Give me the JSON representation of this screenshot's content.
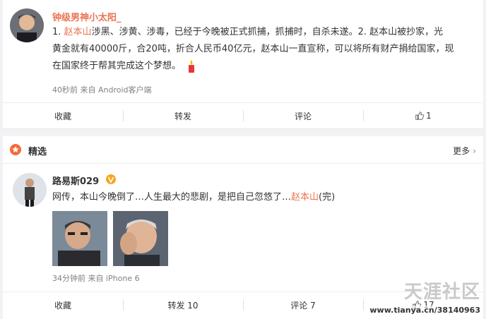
{
  "colors": {
    "accent": "#eb7350",
    "link": "#eb7350",
    "text": "#333333",
    "muted": "#808080",
    "verified": "#f5a623"
  },
  "post1": {
    "author": "钟级男神小太阳_",
    "line1_prefix": "1. ",
    "line1_name": "赵本山",
    "line1_rest": "涉黑、涉黄、涉毒，已经于今晚被正式抓捕，抓捕时，自杀未遂。2. 赵本山被抄家，光",
    "line2": "黄金就有40000斤，合20吨，折合人民币40亿元，赵本山一直宣称，可以将所有财产捐给国家，现",
    "line3": "在国家终于帮其完成这个梦想。",
    "emoji_icon": "candle-icon",
    "meta": "40秒前 来自 Android客户端",
    "actions": {
      "favorite": "收藏",
      "repost": "转发",
      "comment": "评论",
      "like_count": "1"
    }
  },
  "featured": {
    "label": "精选",
    "more": "更多",
    "icon": "star-icon"
  },
  "post2": {
    "author": "路易斯029",
    "verified_icon": "vip-badge-icon",
    "text_prefix": "网传，本山今晚倒了…人生最大的悲剧，是把自己忽悠了…",
    "text_name": "赵本山",
    "text_suffix": "(完)",
    "meta": "34分钟前 来自 iPhone 6",
    "actions": {
      "favorite": "收藏",
      "repost": "转发 10",
      "comment": "评论 7",
      "like_count": "17"
    }
  },
  "watermark": {
    "logo": "天涯社区",
    "url": "www.tianya.cn/38140963"
  }
}
